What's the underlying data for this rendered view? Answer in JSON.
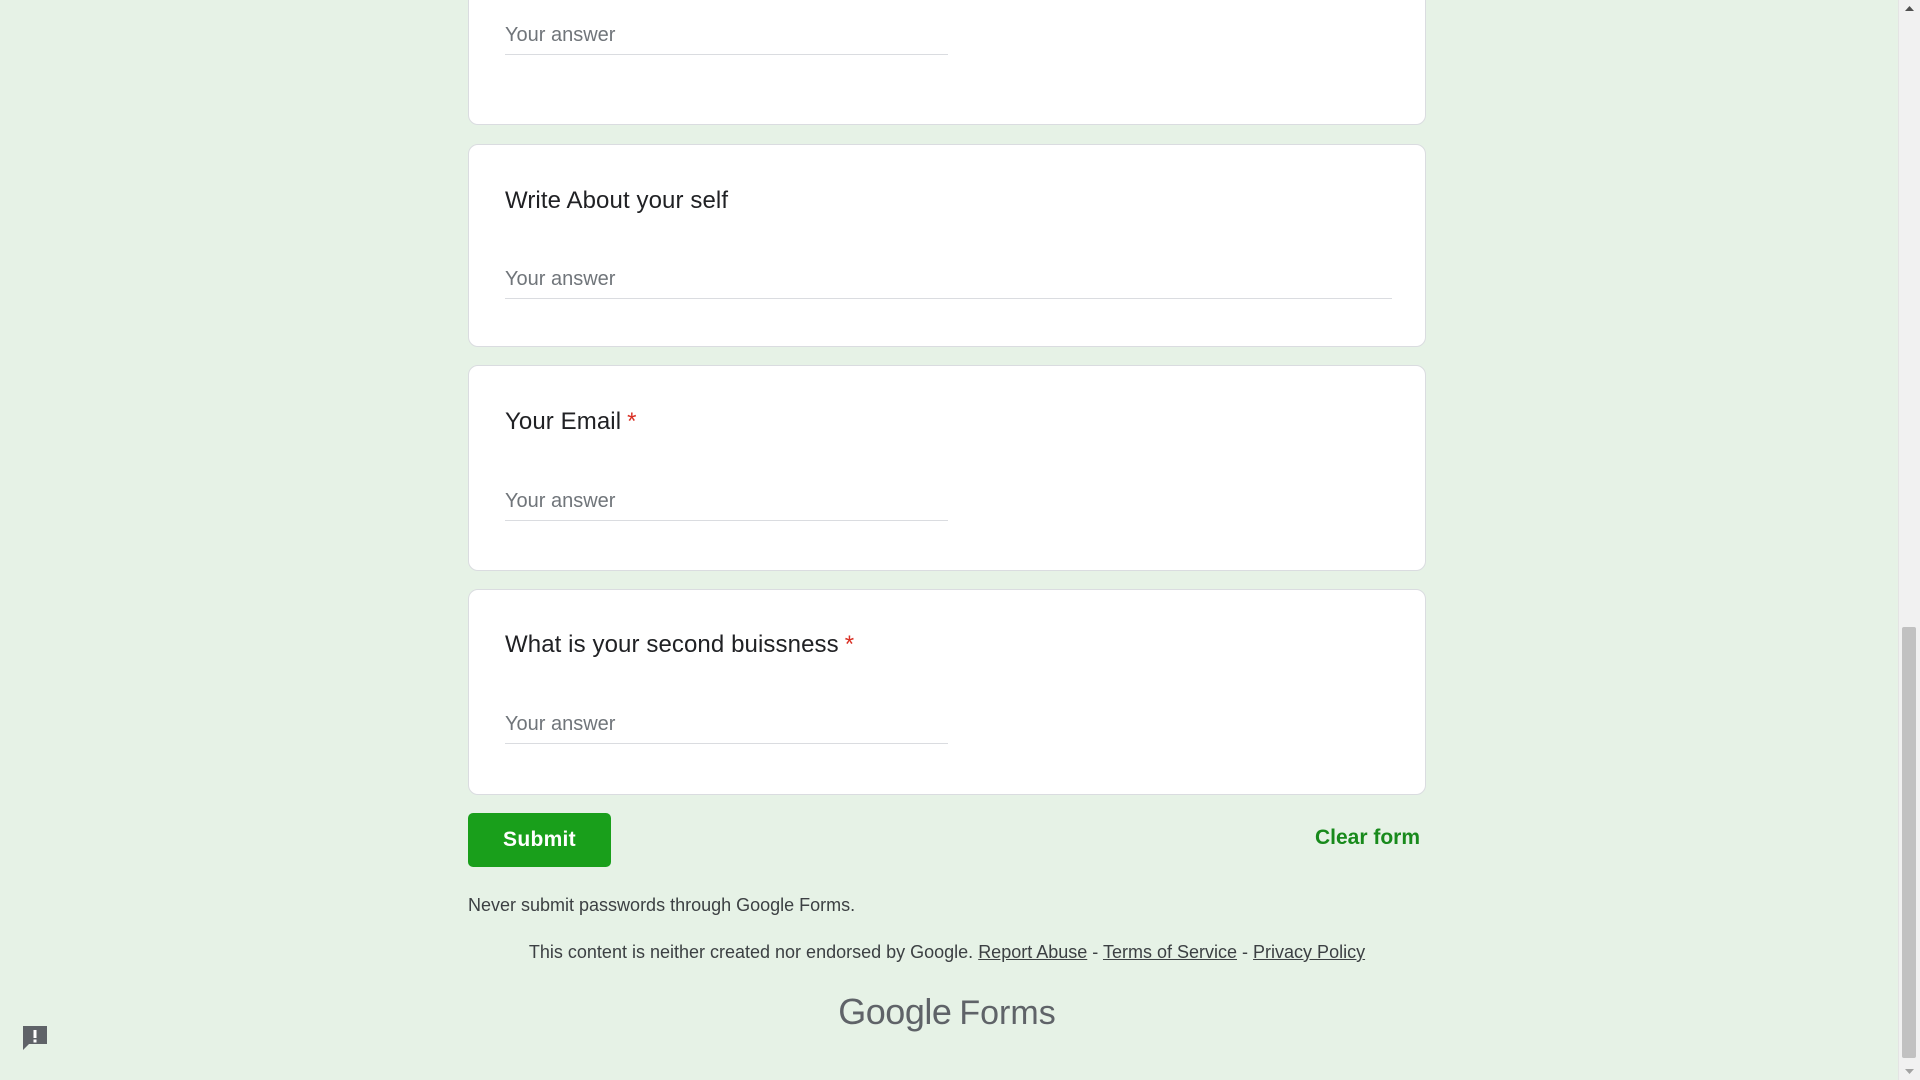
{
  "form": {
    "questions": [
      {
        "title": "",
        "required": false,
        "placeholder": "Your answer",
        "value": ""
      },
      {
        "title": "Write About your self",
        "required": false,
        "placeholder": "Your answer",
        "value": ""
      },
      {
        "title": "Your Email",
        "required": true,
        "placeholder": "Your answer",
        "value": ""
      },
      {
        "title": "What is your second buissness",
        "required": true,
        "placeholder": "Your answer",
        "value": ""
      }
    ],
    "required_marker": "*",
    "submit_label": "Submit",
    "clear_label": "Clear form"
  },
  "footer": {
    "password_note": "Never submit passwords through Google Forms.",
    "disclaimer_text": "This content is neither created nor endorsed by Google.",
    "report_abuse": "Report Abuse",
    "terms": "Terms of Service",
    "privacy": "Privacy Policy",
    "separator": "-",
    "brand_google": "Google",
    "brand_forms": "Forms"
  },
  "colors": {
    "page_background": "#e6f2e6",
    "accent": "#199f1b",
    "required": "#d93025"
  },
  "icons": {
    "feedback": "report-feedback-icon",
    "scroll_up": "arrow-up-icon",
    "scroll_down": "arrow-down-icon"
  }
}
